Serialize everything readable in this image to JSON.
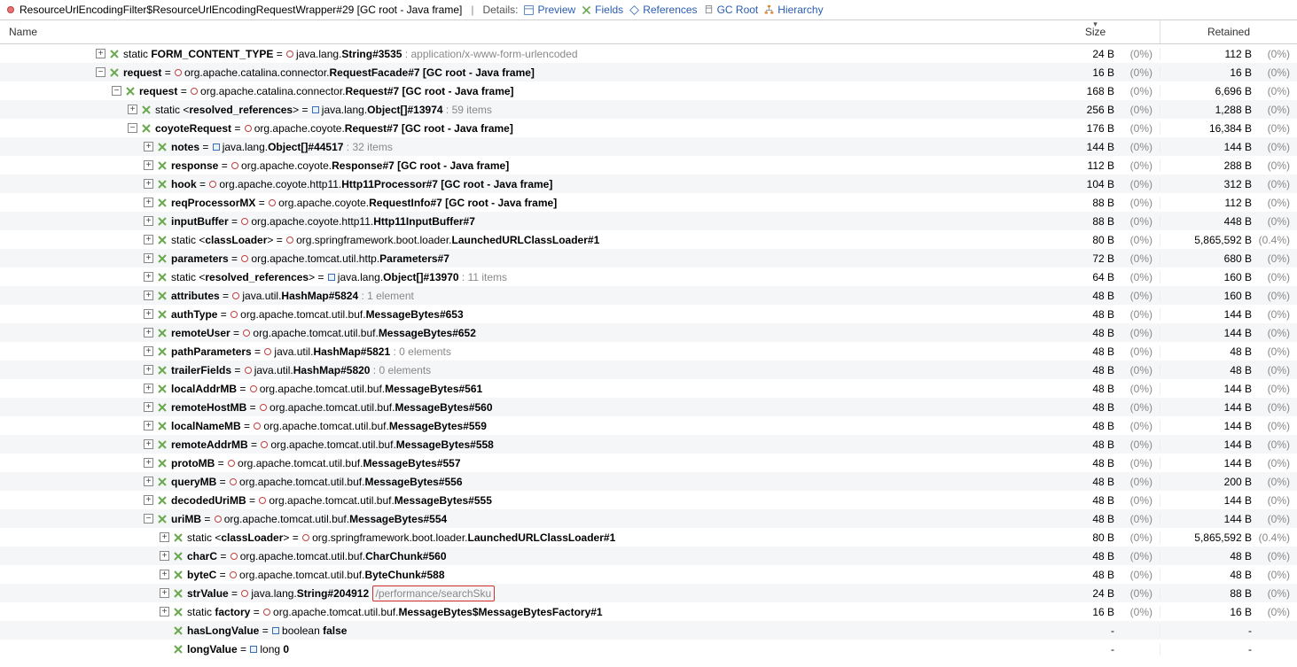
{
  "toolbar": {
    "title": "ResourceUrlEncodingFilter$ResourceUrlEncodingRequestWrapper#29 [GC root - Java frame]",
    "details_label": "Details:",
    "preview": "Preview",
    "fields": "Fields",
    "references": "References",
    "gcroot": "GC Root",
    "hierarchy": "Hierarchy"
  },
  "header": {
    "name": "Name",
    "size": "Size",
    "retained": "Retained"
  },
  "rows": [
    {
      "indent": 6,
      "exp": "+",
      "iconColor": "#6aa84f",
      "label_pre": "static ",
      "label_bold": "FORM_CONTENT_TYPE",
      "label_mid": " = ",
      "circle": true,
      "class_pre": "java.lang.",
      "class_bold": "String#3535",
      "grey": " : application/x-www-form-urlencoded",
      "size": "24 B",
      "sizepct": "(0%)",
      "ret": "112 B",
      "retpct": "(0%)"
    },
    {
      "indent": 6,
      "exp": "-",
      "iconColor": "#6aa84f",
      "label_bold": "request",
      "label_mid": " = ",
      "circle": true,
      "class_pre": "org.apache.catalina.connector.",
      "class_bold": "RequestFacade#7 [GC root - Java frame]",
      "size": "16 B",
      "sizepct": "(0%)",
      "ret": "16 B",
      "retpct": "(0%)"
    },
    {
      "indent": 7,
      "exp": "-",
      "iconColor": "#6aa84f",
      "label_bold": "request",
      "label_mid": " = ",
      "circle": true,
      "class_pre": "org.apache.catalina.connector.",
      "class_bold": "Request#7 [GC root - Java frame]",
      "size": "168 B",
      "sizepct": "(0%)",
      "ret": "6,696 B",
      "retpct": "(0%)"
    },
    {
      "indent": 8,
      "exp": "+",
      "iconColor": "#6aa84f",
      "label_pre": "static <",
      "label_bold": "resolved_references",
      "label_mid": "> = ",
      "square": true,
      "class_pre": "java.lang.",
      "class_bold": "Object[]#13974",
      "grey": " : 59 items",
      "size": "256 B",
      "sizepct": "(0%)",
      "ret": "1,288 B",
      "retpct": "(0%)"
    },
    {
      "indent": 8,
      "exp": "-",
      "iconColor": "#6aa84f",
      "label_bold": "coyoteRequest",
      "label_mid": " = ",
      "circle": true,
      "class_pre": "org.apache.coyote.",
      "class_bold": "Request#7 [GC root - Java frame]",
      "size": "176 B",
      "sizepct": "(0%)",
      "ret": "16,384 B",
      "retpct": "(0%)"
    },
    {
      "indent": 9,
      "exp": "+",
      "iconColor": "#6aa84f",
      "label_bold": "notes",
      "label_mid": " = ",
      "square": true,
      "class_pre": "java.lang.",
      "class_bold": "Object[]#44517",
      "grey": " : 32 items",
      "size": "144 B",
      "sizepct": "(0%)",
      "ret": "144 B",
      "retpct": "(0%)"
    },
    {
      "indent": 9,
      "exp": "+",
      "iconColor": "#6aa84f",
      "label_bold": "response",
      "label_mid": " = ",
      "circle": true,
      "class_pre": "org.apache.coyote.",
      "class_bold": "Response#7 [GC root - Java frame]",
      "size": "112 B",
      "sizepct": "(0%)",
      "ret": "288 B",
      "retpct": "(0%)"
    },
    {
      "indent": 9,
      "exp": "+",
      "iconColor": "#6aa84f",
      "label_bold": "hook",
      "label_mid": " = ",
      "circle": true,
      "class_pre": "org.apache.coyote.http11.",
      "class_bold": "Http11Processor#7 [GC root - Java frame]",
      "size": "104 B",
      "sizepct": "(0%)",
      "ret": "312 B",
      "retpct": "(0%)"
    },
    {
      "indent": 9,
      "exp": "+",
      "iconColor": "#6aa84f",
      "label_bold": "reqProcessorMX",
      "label_mid": " = ",
      "circle": true,
      "class_pre": "org.apache.coyote.",
      "class_bold": "RequestInfo#7 [GC root - Java frame]",
      "size": "88 B",
      "sizepct": "(0%)",
      "ret": "112 B",
      "retpct": "(0%)"
    },
    {
      "indent": 9,
      "exp": "+",
      "iconColor": "#6aa84f",
      "label_bold": "inputBuffer",
      "label_mid": " = ",
      "circle": true,
      "class_pre": "org.apache.coyote.http11.",
      "class_bold": "Http11InputBuffer#7",
      "size": "88 B",
      "sizepct": "(0%)",
      "ret": "448 B",
      "retpct": "(0%)"
    },
    {
      "indent": 9,
      "exp": "+",
      "iconColor": "#6aa84f",
      "label_pre": "static <",
      "label_bold": "classLoader",
      "label_mid": "> = ",
      "circle": true,
      "class_pre": "org.springframework.boot.loader.",
      "class_bold": "LaunchedURLClassLoader#1",
      "size": "80 B",
      "sizepct": "(0%)",
      "ret": "5,865,592 B",
      "retpct": "(0.4%)"
    },
    {
      "indent": 9,
      "exp": "+",
      "iconColor": "#6aa84f",
      "label_bold": "parameters",
      "label_mid": " = ",
      "circle": true,
      "class_pre": "org.apache.tomcat.util.http.",
      "class_bold": "Parameters#7",
      "size": "72 B",
      "sizepct": "(0%)",
      "ret": "680 B",
      "retpct": "(0%)"
    },
    {
      "indent": 9,
      "exp": "+",
      "iconColor": "#6aa84f",
      "label_pre": "static <",
      "label_bold": "resolved_references",
      "label_mid": "> = ",
      "square": true,
      "class_pre": "java.lang.",
      "class_bold": "Object[]#13970",
      "grey": " : 11 items",
      "size": "64 B",
      "sizepct": "(0%)",
      "ret": "160 B",
      "retpct": "(0%)"
    },
    {
      "indent": 9,
      "exp": "+",
      "iconColor": "#6aa84f",
      "label_bold": "attributes",
      "label_mid": " = ",
      "circle": true,
      "class_pre": "java.util.",
      "class_bold": "HashMap#5824",
      "grey": " : 1 element",
      "size": "48 B",
      "sizepct": "(0%)",
      "ret": "160 B",
      "retpct": "(0%)"
    },
    {
      "indent": 9,
      "exp": "+",
      "iconColor": "#6aa84f",
      "label_bold": "authType",
      "label_mid": " = ",
      "circle": true,
      "class_pre": "org.apache.tomcat.util.buf.",
      "class_bold": "MessageBytes#653",
      "size": "48 B",
      "sizepct": "(0%)",
      "ret": "144 B",
      "retpct": "(0%)"
    },
    {
      "indent": 9,
      "exp": "+",
      "iconColor": "#6aa84f",
      "label_bold": "remoteUser",
      "label_mid": " = ",
      "circle": true,
      "class_pre": "org.apache.tomcat.util.buf.",
      "class_bold": "MessageBytes#652",
      "size": "48 B",
      "sizepct": "(0%)",
      "ret": "144 B",
      "retpct": "(0%)"
    },
    {
      "indent": 9,
      "exp": "+",
      "iconColor": "#6aa84f",
      "label_bold": "pathParameters",
      "label_mid": " = ",
      "circle": true,
      "class_pre": "java.util.",
      "class_bold": "HashMap#5821",
      "grey": " : 0 elements",
      "size": "48 B",
      "sizepct": "(0%)",
      "ret": "48 B",
      "retpct": "(0%)"
    },
    {
      "indent": 9,
      "exp": "+",
      "iconColor": "#6aa84f",
      "label_bold": "trailerFields",
      "label_mid": " = ",
      "circle": true,
      "class_pre": "java.util.",
      "class_bold": "HashMap#5820",
      "grey": " : 0 elements",
      "size": "48 B",
      "sizepct": "(0%)",
      "ret": "48 B",
      "retpct": "(0%)"
    },
    {
      "indent": 9,
      "exp": "+",
      "iconColor": "#6aa84f",
      "label_bold": "localAddrMB",
      "label_mid": " = ",
      "circle": true,
      "class_pre": "org.apache.tomcat.util.buf.",
      "class_bold": "MessageBytes#561",
      "size": "48 B",
      "sizepct": "(0%)",
      "ret": "144 B",
      "retpct": "(0%)"
    },
    {
      "indent": 9,
      "exp": "+",
      "iconColor": "#6aa84f",
      "label_bold": "remoteHostMB",
      "label_mid": " = ",
      "circle": true,
      "class_pre": "org.apache.tomcat.util.buf.",
      "class_bold": "MessageBytes#560",
      "size": "48 B",
      "sizepct": "(0%)",
      "ret": "144 B",
      "retpct": "(0%)"
    },
    {
      "indent": 9,
      "exp": "+",
      "iconColor": "#6aa84f",
      "label_bold": "localNameMB",
      "label_mid": " = ",
      "circle": true,
      "class_pre": "org.apache.tomcat.util.buf.",
      "class_bold": "MessageBytes#559",
      "size": "48 B",
      "sizepct": "(0%)",
      "ret": "144 B",
      "retpct": "(0%)"
    },
    {
      "indent": 9,
      "exp": "+",
      "iconColor": "#6aa84f",
      "label_bold": "remoteAddrMB",
      "label_mid": " = ",
      "circle": true,
      "class_pre": "org.apache.tomcat.util.buf.",
      "class_bold": "MessageBytes#558",
      "size": "48 B",
      "sizepct": "(0%)",
      "ret": "144 B",
      "retpct": "(0%)"
    },
    {
      "indent": 9,
      "exp": "+",
      "iconColor": "#6aa84f",
      "label_bold": "protoMB",
      "label_mid": " = ",
      "circle": true,
      "class_pre": "org.apache.tomcat.util.buf.",
      "class_bold": "MessageBytes#557",
      "size": "48 B",
      "sizepct": "(0%)",
      "ret": "144 B",
      "retpct": "(0%)"
    },
    {
      "indent": 9,
      "exp": "+",
      "iconColor": "#6aa84f",
      "label_bold": "queryMB",
      "label_mid": " = ",
      "circle": true,
      "class_pre": "org.apache.tomcat.util.buf.",
      "class_bold": "MessageBytes#556",
      "size": "48 B",
      "sizepct": "(0%)",
      "ret": "200 B",
      "retpct": "(0%)"
    },
    {
      "indent": 9,
      "exp": "+",
      "iconColor": "#6aa84f",
      "label_bold": "decodedUriMB",
      "label_mid": " = ",
      "circle": true,
      "class_pre": "org.apache.tomcat.util.buf.",
      "class_bold": "MessageBytes#555",
      "size": "48 B",
      "sizepct": "(0%)",
      "ret": "144 B",
      "retpct": "(0%)"
    },
    {
      "indent": 9,
      "exp": "-",
      "iconColor": "#6aa84f",
      "label_bold": "uriMB",
      "label_mid": " = ",
      "circle": true,
      "class_pre": "org.apache.tomcat.util.buf.",
      "class_bold": "MessageBytes#554",
      "size": "48 B",
      "sizepct": "(0%)",
      "ret": "144 B",
      "retpct": "(0%)"
    },
    {
      "indent": 10,
      "exp": "+",
      "iconColor": "#6aa84f",
      "label_pre": "static <",
      "label_bold": "classLoader",
      "label_mid": "> = ",
      "circle": true,
      "class_pre": "org.springframework.boot.loader.",
      "class_bold": "LaunchedURLClassLoader#1",
      "size": "80 B",
      "sizepct": "(0%)",
      "ret": "5,865,592 B",
      "retpct": "(0.4%)"
    },
    {
      "indent": 10,
      "exp": "+",
      "iconColor": "#6aa84f",
      "label_bold": "charC",
      "label_mid": " = ",
      "circle": true,
      "class_pre": "org.apache.tomcat.util.buf.",
      "class_bold": "CharChunk#560",
      "size": "48 B",
      "sizepct": "(0%)",
      "ret": "48 B",
      "retpct": "(0%)"
    },
    {
      "indent": 10,
      "exp": "+",
      "iconColor": "#6aa84f",
      "label_bold": "byteC",
      "label_mid": " = ",
      "circle": true,
      "class_pre": "org.apache.tomcat.util.buf.",
      "class_bold": "ByteChunk#588",
      "size": "48 B",
      "sizepct": "(0%)",
      "ret": "48 B",
      "retpct": "(0%)"
    },
    {
      "indent": 10,
      "exp": "+",
      "iconColor": "#6aa84f",
      "label_bold": "strValue",
      "label_mid": " = ",
      "circle": true,
      "class_pre": "java.lang.",
      "class_bold": "String#204912",
      "redbox": "/performance/searchSku",
      "size": "24 B",
      "sizepct": "(0%)",
      "ret": "88 B",
      "retpct": "(0%)"
    },
    {
      "indent": 10,
      "exp": "+",
      "iconColor": "#6aa84f",
      "label_pre": "static ",
      "label_bold": "factory",
      "label_mid": " = ",
      "circle": true,
      "class_pre": "org.apache.tomcat.util.buf.",
      "class_bold": "MessageBytes$MessageBytesFactory#1",
      "size": "16 B",
      "sizepct": "(0%)",
      "ret": "16 B",
      "retpct": "(0%)"
    },
    {
      "indent": 10,
      "exp": "",
      "iconColor": "#6aa84f",
      "label_bold": "hasLongValue",
      "label_mid": " = ",
      "square": true,
      "class_pre": "boolean ",
      "class_bold": "false",
      "size": "-",
      "sizepct": "",
      "ret": "-",
      "retpct": ""
    },
    {
      "indent": 10,
      "exp": "",
      "iconColor": "#6aa84f",
      "label_bold": "longValue",
      "label_mid": " = ",
      "square": true,
      "class_pre": "long ",
      "class_bold": "0",
      "size": "-",
      "sizepct": "",
      "ret": "-",
      "retpct": ""
    }
  ]
}
